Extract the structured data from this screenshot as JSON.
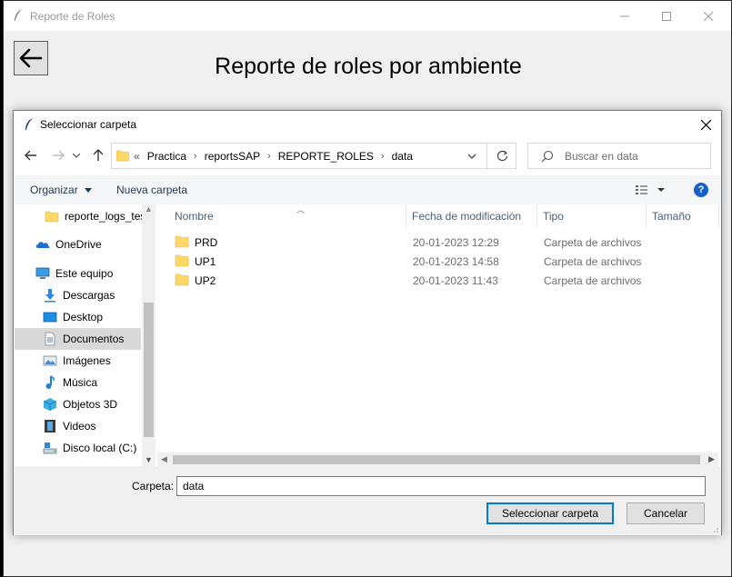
{
  "main_window": {
    "title": "Reporte de Roles",
    "heading": "Reporte de roles por ambiente",
    "controls": {
      "minimize": "—",
      "maximize": "☐",
      "close": "✕"
    }
  },
  "dialog": {
    "title": "Seleccionar carpeta",
    "address": {
      "overflow": "«",
      "segments": [
        "Practica",
        "reportsSAP",
        "REPORTE_ROLES",
        "data"
      ]
    },
    "search_placeholder": "Buscar en data",
    "commands": {
      "organize": "Organizar",
      "new_folder": "Nueva carpeta"
    },
    "nav_items": [
      {
        "label": "reporte_logs_tes",
        "icon": "folder-icon"
      },
      {
        "label": "OneDrive",
        "icon": "onedrive-icon"
      },
      {
        "label": "Este equipo",
        "icon": "computer-icon"
      },
      {
        "label": "Descargas",
        "icon": "downloads-icon"
      },
      {
        "label": "Desktop",
        "icon": "desktop-icon"
      },
      {
        "label": "Documentos",
        "icon": "documents-icon",
        "selected": true
      },
      {
        "label": "Imágenes",
        "icon": "pictures-icon"
      },
      {
        "label": "Música",
        "icon": "music-icon"
      },
      {
        "label": "Objetos 3D",
        "icon": "objects-3d-icon"
      },
      {
        "label": "Videos",
        "icon": "videos-icon"
      },
      {
        "label": "Disco local (C:)",
        "icon": "drive-icon"
      }
    ],
    "columns": [
      "Nombre",
      "Fecha de modificación",
      "Tipo",
      "Tamaño"
    ],
    "files": [
      {
        "name": "PRD",
        "modified": "20-01-2023 12:29",
        "type": "Carpeta de archivos"
      },
      {
        "name": "UP1",
        "modified": "20-01-2023 14:58",
        "type": "Carpeta de archivos"
      },
      {
        "name": "UP2",
        "modified": "20-01-2023 11:43",
        "type": "Carpeta de archivos"
      }
    ],
    "folder_label": "Carpeta:",
    "folder_value": "data",
    "buttons": {
      "select": "Seleccionar carpeta",
      "cancel": "Cancelar"
    }
  },
  "colors": {
    "accent": "#0078d7",
    "folder": "#ffd766",
    "help": "#1660c8",
    "selected_bg": "#d9d9d9"
  }
}
